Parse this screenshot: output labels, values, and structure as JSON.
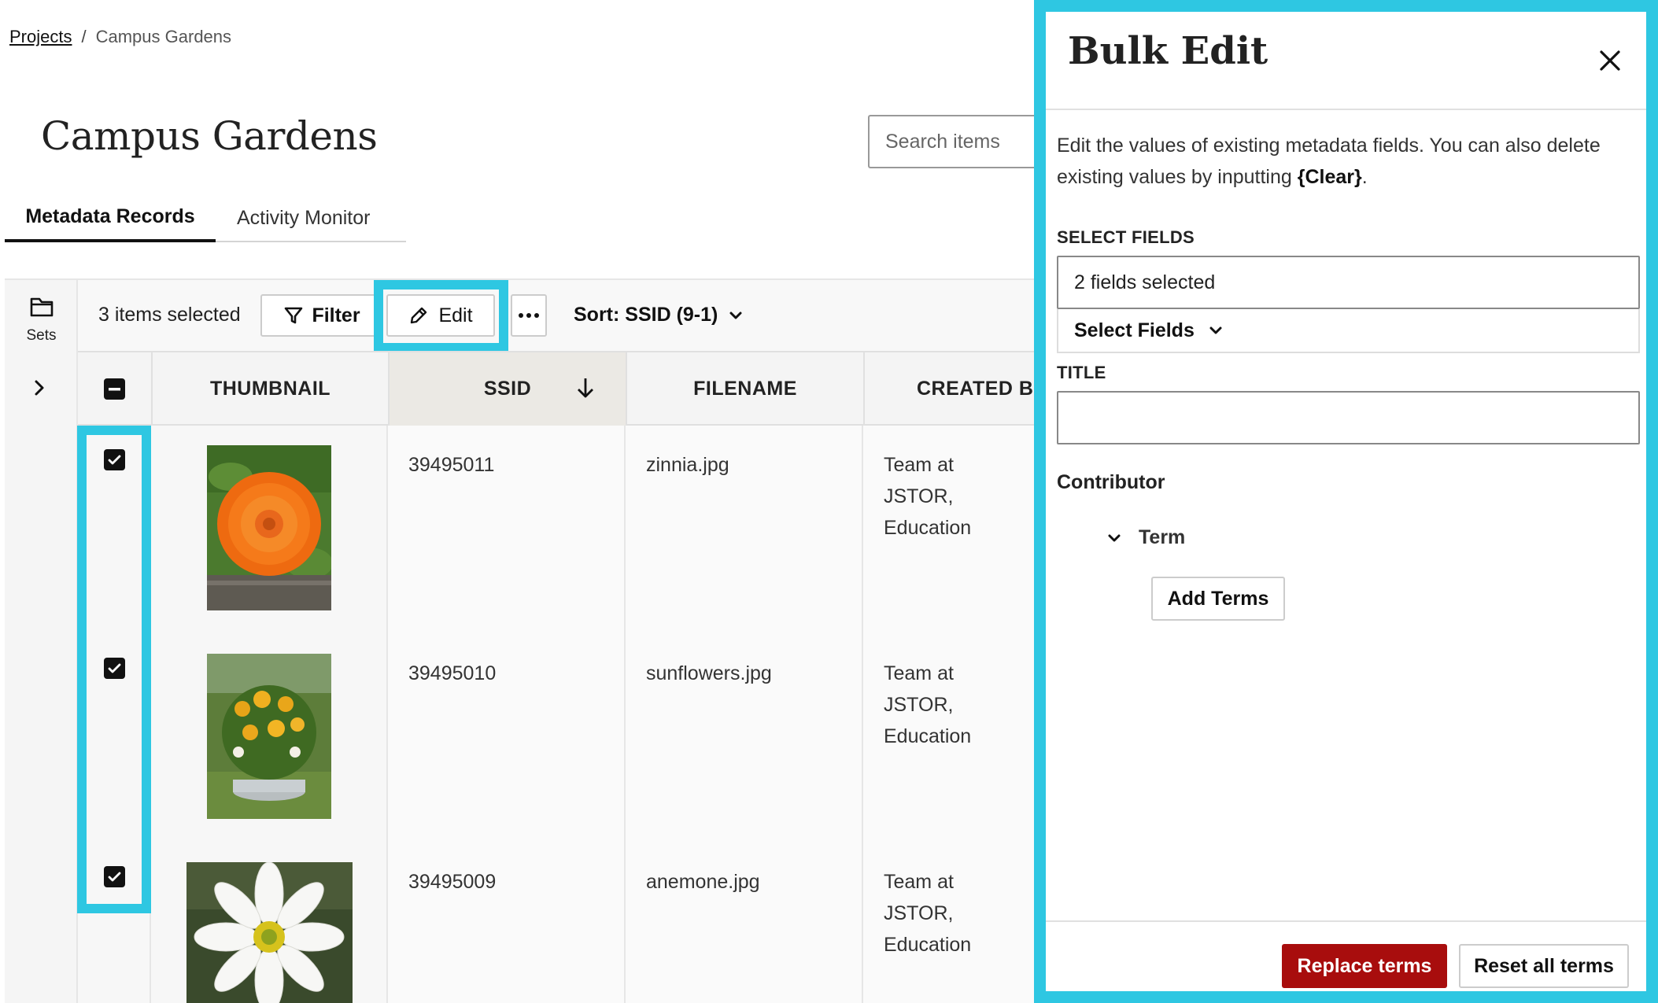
{
  "breadcrumb": {
    "projects_link": "Projects",
    "separator": "/",
    "current": "Campus Gardens"
  },
  "page": {
    "title": "Campus Gardens"
  },
  "search": {
    "placeholder": "Search items"
  },
  "tabs": [
    {
      "label": "Metadata Records",
      "active": true
    },
    {
      "label": "Activity Monitor",
      "active": false
    }
  ],
  "rail": {
    "sets_label": "Sets",
    "folder_icon": "folder-icon",
    "expand_icon": "chevron-right-icon"
  },
  "toolbar": {
    "selected_count": "3 items selected",
    "filter_label": "Filter",
    "edit_label": "Edit",
    "more_icon": "ellipsis-icon",
    "sort_label": "Sort: SSID (9-1)"
  },
  "table": {
    "columns": {
      "thumbnail": "THUMBNAIL",
      "ssid": "SSID",
      "filename": "FILENAME",
      "created_by": "CREATED B"
    },
    "rows": [
      {
        "ssid": "39495011",
        "filename": "zinnia.jpg",
        "created_line1": "Team at JSTOR,",
        "created_line2": "Education",
        "checked": true
      },
      {
        "ssid": "39495010",
        "filename": "sunflowers.jpg",
        "created_line1": "Team at JSTOR,",
        "created_line2": "Education",
        "checked": true
      },
      {
        "ssid": "39495009",
        "filename": "anemone.jpg",
        "created_line1": "Team at JSTOR,",
        "created_line2": "Education",
        "checked": true
      }
    ]
  },
  "panel": {
    "title": "Bulk Edit",
    "intro_text": "Edit the values of existing metadata fields. You can also delete existing values by inputting ",
    "intro_clear": "{Clear}",
    "intro_end": ".",
    "select_fields_label": "SELECT FIELDS",
    "fields_selected_value": "2 fields selected",
    "select_fields_button": "Select Fields",
    "title_label": "TITLE",
    "title_value": "",
    "contributor_label": "Contributor",
    "term_label": "Term",
    "add_terms_button": "Add Terms",
    "replace_button": "Replace terms",
    "reset_button": "Reset all terms"
  },
  "colors": {
    "highlight": "#2ec7e2",
    "primary_button": "#a80d0d"
  }
}
